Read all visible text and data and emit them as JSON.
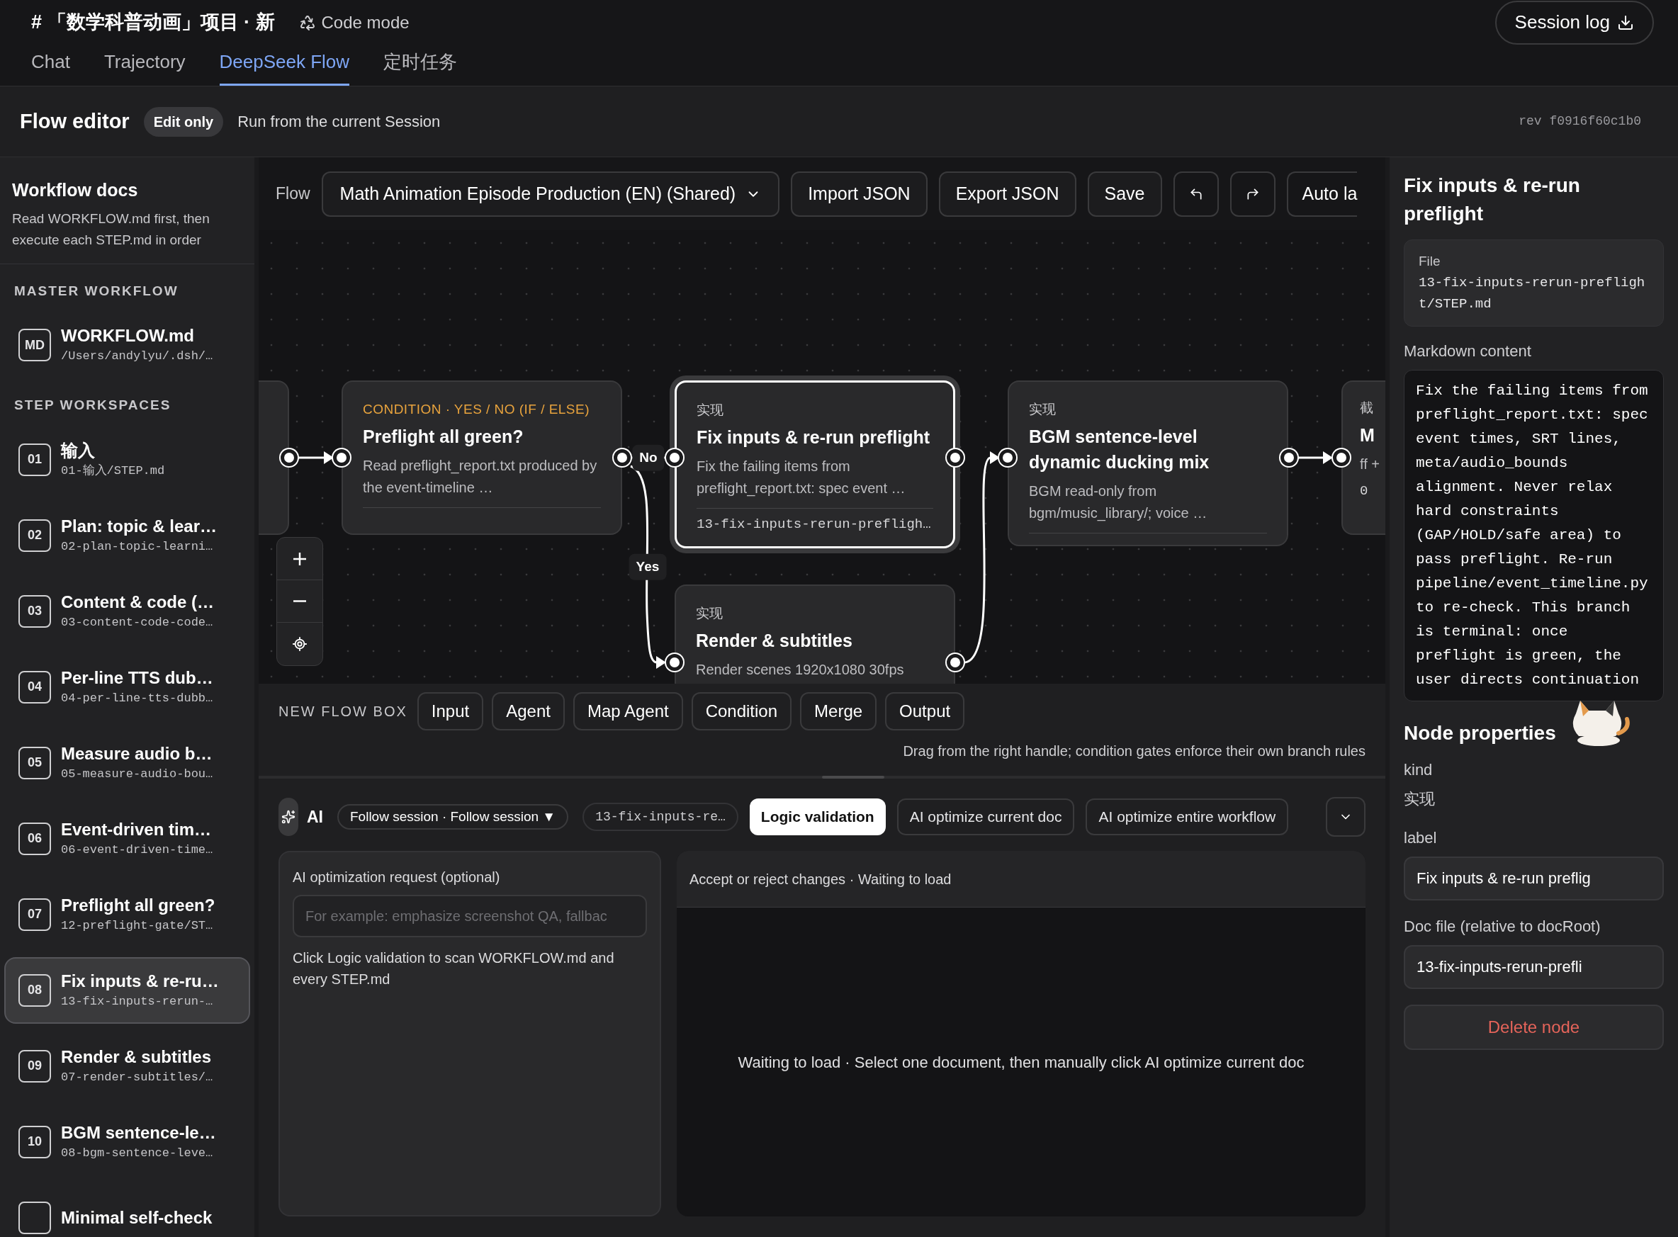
{
  "header": {
    "title": "# 「数学科普动画」项目 · 新",
    "mode": "Code mode",
    "session_log": "Session log"
  },
  "tabs": [
    {
      "label": "Chat",
      "selected": false
    },
    {
      "label": "Trajectory",
      "selected": false
    },
    {
      "label": "DeepSeek Flow",
      "selected": true
    },
    {
      "label": "定时任务",
      "selected": false
    }
  ],
  "editor_bar": {
    "title": "Flow editor",
    "badge": "Edit only",
    "subtitle": "Run from the current Session",
    "rev": "rev f0916f60c1b0"
  },
  "sidebar": {
    "title": "Workflow docs",
    "description": "Read WORKFLOW.md first, then execute each STEP.md in order",
    "sections": [
      {
        "heading": "MASTER WORKFLOW",
        "items": [
          {
            "badge": "MD",
            "title": "WORKFLOW.md",
            "path": "/Users/andylyu/.dsh/…",
            "selected": false
          }
        ]
      },
      {
        "heading": "STEP WORKSPACES",
        "items": [
          {
            "badge": "01",
            "title": "输入",
            "path": "01-输入/STEP.md",
            "selected": false
          },
          {
            "badge": "02",
            "title": "Plan: topic & lear…",
            "path": "02-plan-topic-learni…",
            "selected": false
          },
          {
            "badge": "03",
            "title": "Content & code (…",
            "path": "03-content-code-code…",
            "selected": false
          },
          {
            "badge": "04",
            "title": "Per-line TTS dub…",
            "path": "04-per-line-tts-dubb…",
            "selected": false
          },
          {
            "badge": "05",
            "title": "Measure audio b…",
            "path": "05-measure-audio-bou…",
            "selected": false
          },
          {
            "badge": "06",
            "title": "Event-driven tim…",
            "path": "06-event-driven-time…",
            "selected": false
          },
          {
            "badge": "07",
            "title": "Preflight all green?",
            "path": "12-preflight-gate/ST…",
            "selected": false
          },
          {
            "badge": "08",
            "title": "Fix inputs & re-ru…",
            "path": "13-fix-inputs-rerun-…",
            "selected": true
          },
          {
            "badge": "09",
            "title": "Render & subtitles",
            "path": "07-render-subtitles/…",
            "selected": false
          },
          {
            "badge": "10",
            "title": "BGM sentence-le…",
            "path": "08-bgm-sentence-leve…",
            "selected": false
          },
          {
            "title": "Minimal self-check",
            "selected": false
          }
        ]
      }
    ]
  },
  "toolbar": {
    "flow_label": "Flow",
    "flow_select": "Math Animation Episode Production (EN) (Shared)",
    "buttons": [
      "Import JSON",
      "Export JSON",
      "Save"
    ],
    "more_button": "Auto la"
  },
  "canvas": {
    "nodes": [
      {
        "kind": "clipped",
        "selected": false
      },
      {
        "kind": "condition",
        "kind_label": "CONDITION · YES / NO (IF / ELSE)",
        "title": "Preflight all green?",
        "description": "Read preflight_report.txt produced by the event-timeline …",
        "selected": false
      },
      {
        "kind": "step",
        "kind_label": "实现",
        "title": "Fix inputs & re-run preflight",
        "description": "Fix the failing items from preflight_report.txt: spec event …",
        "file": "13-fix-inputs-rerun-prefligh…",
        "selected": true
      },
      {
        "kind": "step",
        "kind_label": "实现",
        "title": "BGM sentence-level dynamic ducking mix",
        "description": "BGM read-only from bgm/music_library/; voice …",
        "selected": false
      },
      {
        "kind": "clipped",
        "kind_label": "截",
        "title": "M",
        "description": "ff +",
        "file": "0",
        "selected": false
      },
      {
        "kind": "step",
        "kind_label": "实现",
        "title": "Render & subtitles",
        "description": "Render scenes 1920x1080 30fps",
        "selected": false
      }
    ],
    "edges": [
      {
        "kind": "plain"
      },
      {
        "kind": "labeled",
        "label": "No"
      },
      {
        "kind": "labeled",
        "label": "Yes"
      },
      {
        "kind": "plain"
      },
      {
        "kind": "plain"
      }
    ]
  },
  "new_flow_box": {
    "label": "NEW FLOW BOX",
    "buttons": [
      "Input",
      "Agent",
      "Map Agent",
      "Condition",
      "Merge",
      "Output"
    ],
    "hint": "Drag from the right handle; condition gates enforce their own branch rules"
  },
  "ai": {
    "label": "AI",
    "model_select": "Follow session · Follow session ▼",
    "doc_chip": "13-fix-inputs-re…",
    "actions": [
      {
        "label": "Logic validation",
        "selected": true
      },
      {
        "label": "AI optimize current doc",
        "selected": false
      },
      {
        "label": "AI optimize entire workflow",
        "selected": false
      }
    ],
    "request_panel": {
      "label": "AI optimization request (optional)",
      "placeholder": "For example: emphasize screenshot QA, fallbac",
      "note": "Click Logic validation to scan WORKFLOW.md and every STEP.md"
    },
    "review_panel": {
      "header": "Accept or reject changes · Waiting to load",
      "message": "Waiting to load · Select one document, then manually click AI optimize current doc"
    }
  },
  "inspector": {
    "title": "Fix inputs & re-run preflight",
    "file_label": "File",
    "file": "13-fix-inputs-rerun-preflight/STEP.md",
    "content_label": "Markdown content",
    "content": "Fix the failing items from preflight_report.txt: spec event times, SRT lines, meta/audio_bounds alignment. Never relax hard constraints (GAP/HOLD/safe area) to pass preflight. Re-run pipeline/event_timeline.py to re-check. This branch is terminal: once preflight is green, the user directs continuation",
    "properties_title": "Node properties",
    "kind_label": "kind",
    "kind_value": "实现",
    "label_label": "label",
    "label_value": "Fix inputs & re-run preflig",
    "doc_label": "Doc file (relative to docRoot)",
    "doc_value": "13-fix-inputs-rerun-prefli",
    "delete": "Delete node"
  }
}
